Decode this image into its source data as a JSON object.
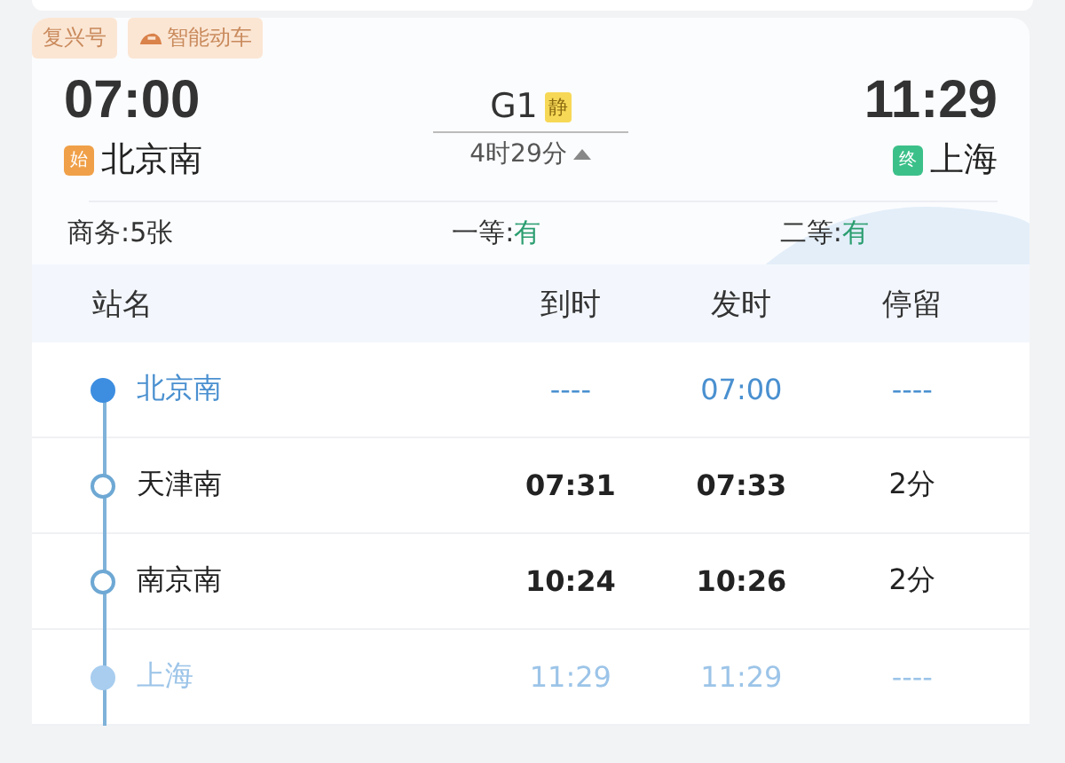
{
  "tags": [
    {
      "label": "复兴号",
      "kind": "plain"
    },
    {
      "label": "智能动车",
      "kind": "train"
    }
  ],
  "departure": {
    "time": "07:00",
    "badge": "始",
    "station": "北京南"
  },
  "train": {
    "number": "G1",
    "badge": "静",
    "duration": "4时29分",
    "expanded": true
  },
  "arrival": {
    "time": "11:29",
    "badge": "终",
    "station": "上海"
  },
  "seats": [
    {
      "label": "商务:",
      "value": "5张",
      "kind": "count"
    },
    {
      "label": "一等:",
      "value": "有",
      "kind": "status"
    },
    {
      "label": "二等:",
      "value": "有",
      "kind": "status"
    }
  ],
  "table": {
    "columns": [
      "站名",
      "到时",
      "发时",
      "停留"
    ],
    "rows": [
      {
        "kind": "start",
        "station": "北京南",
        "arrive": "----",
        "depart": "07:00",
        "stay": "----"
      },
      {
        "kind": "stop",
        "station": "天津南",
        "arrive": "07:31",
        "depart": "07:33",
        "stay": "2分"
      },
      {
        "kind": "stop",
        "station": "南京南",
        "arrive": "10:24",
        "depart": "10:26",
        "stay": "2分"
      },
      {
        "kind": "end",
        "station": "上海",
        "arrive": "11:29",
        "depart": "11:29",
        "stay": "----"
      }
    ]
  }
}
